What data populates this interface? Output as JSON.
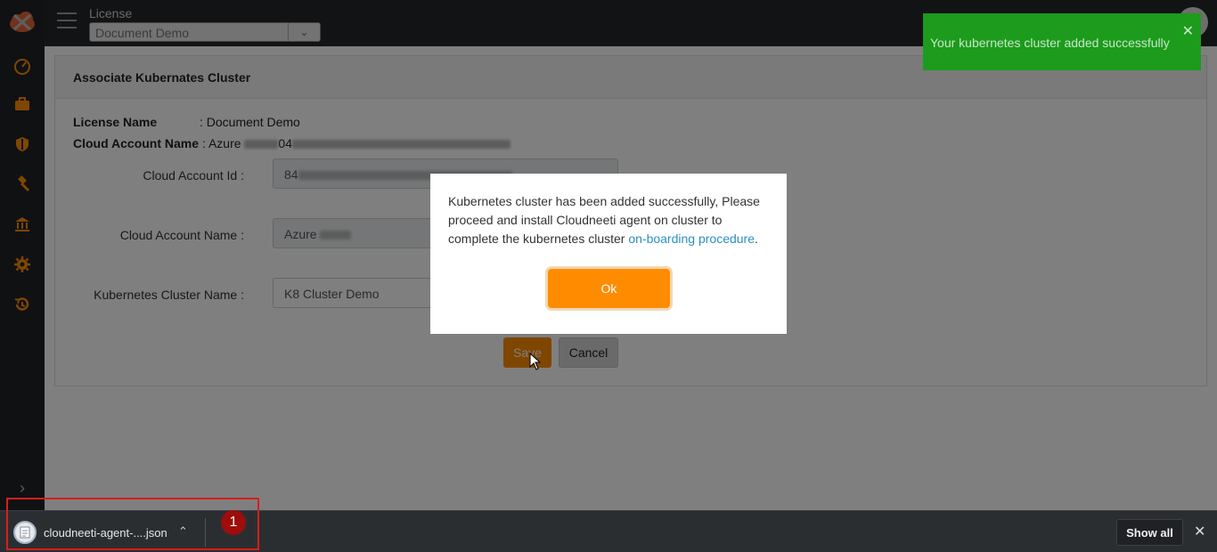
{
  "topbar": {
    "license_label": "License",
    "license_value": "Document Demo"
  },
  "card": {
    "title": "Associate Kubernates Cluster",
    "license_name_key": "License Name",
    "license_name_value": ": Document Demo",
    "cloud_account_name_key": "Cloud Account Name",
    "cloud_account_name_value": ": Azure",
    "cloud_account_name_partial": "04",
    "form": {
      "cloud_account_id_label": "Cloud Account Id :",
      "cloud_account_id_value": "84",
      "cloud_account_name_label": "Cloud Account Name :",
      "cloud_account_name_value": "Azure",
      "cluster_name_label": "Kubernetes Cluster Name :",
      "cluster_name_value": "K8 Cluster Demo"
    },
    "save_label": "Save",
    "cancel_label": "Cancel"
  },
  "toast": {
    "message": "Your kubernetes cluster added successfully",
    "close": "✕"
  },
  "modal": {
    "text_before_link": "Kubernetes cluster has been added successfully, Please proceed and install Cloudneeti agent on cluster to complete the kubernetes cluster ",
    "link_text": "on-boarding procedure",
    "text_after_link": ".",
    "ok_label": "Ok"
  },
  "downloadbar": {
    "file_name": "cloudneeti-agent-....json",
    "badge": "1",
    "show_all_label": "Show all",
    "close": "✕"
  },
  "colors": {
    "accent_orange": "#ff8c00",
    "toast_green": "#1c9b1c",
    "link_blue": "#2a8fc1",
    "sidebar_icon": "#ff8c00"
  }
}
